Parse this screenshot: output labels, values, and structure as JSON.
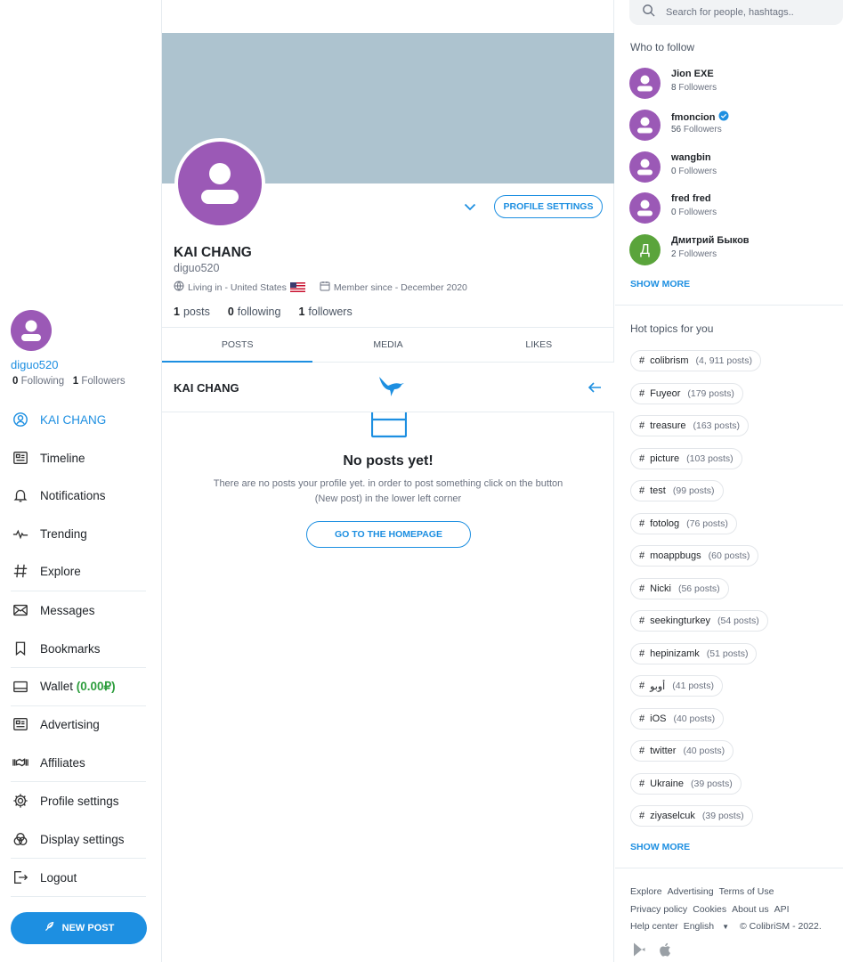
{
  "colors": {
    "accent": "#1d8fe1",
    "avatar_purple": "#9b59b6",
    "avatar_green": "#5aa43b",
    "cover": "#adc3cf",
    "wallet_green": "#2e9e3e"
  },
  "sidebar": {
    "username": "diguo520",
    "following_count": "0",
    "following_label": "Following",
    "followers_count": "1",
    "followers_label": "Followers",
    "items": [
      {
        "label": "KAI CHANG",
        "icon": "user-circle-icon"
      },
      {
        "label": "Timeline",
        "icon": "timeline-icon"
      },
      {
        "label": "Notifications",
        "icon": "bell-icon"
      },
      {
        "label": "Trending",
        "icon": "pulse-icon"
      },
      {
        "label": "Explore",
        "icon": "hashtag-icon"
      },
      {
        "label": "Messages",
        "icon": "envelope-icon"
      },
      {
        "label": "Bookmarks",
        "icon": "bookmark-icon"
      },
      {
        "label": "Wallet",
        "icon": "wallet-icon",
        "amount": "(0.00₽)"
      },
      {
        "label": "Advertising",
        "icon": "advertising-icon"
      },
      {
        "label": "Affiliates",
        "icon": "handshake-icon"
      },
      {
        "label": "Profile settings",
        "icon": "gear-icon"
      },
      {
        "label": "Display settings",
        "icon": "palette-icon"
      },
      {
        "label": "Logout",
        "icon": "logout-icon"
      }
    ],
    "new_post_label": "NEW POST"
  },
  "profile": {
    "name": "KAI CHANG",
    "handle": "diguo520",
    "location": "Living in - United States",
    "member_since": "Member since - December 2020",
    "settings_label": "PROFILE SETTINGS",
    "posts_count": "1",
    "posts_label": "posts",
    "following_count": "0",
    "following_label": "following",
    "followers_count": "1",
    "followers_label": "followers",
    "tabs": [
      "POSTS",
      "MEDIA",
      "LIKES"
    ]
  },
  "feed": {
    "title": "KAI CHANG",
    "empty_title": "No posts yet!",
    "empty_text": "There are no posts your profile yet. in order to post something click on the button (New post) in the lower left corner",
    "home_button": "GO TO THE HOMEPAGE"
  },
  "search": {
    "placeholder": "Search for people, hashtags.."
  },
  "who_to_follow": {
    "heading": "Who to follow",
    "users": [
      {
        "name": "Jion EXE",
        "followers": "8",
        "label": "Followers",
        "verified": false
      },
      {
        "name": "fmoncion",
        "followers": "56",
        "label": "Followers",
        "verified": true
      },
      {
        "name": "wangbin",
        "followers": "0",
        "label": "Followers",
        "verified": false
      },
      {
        "name": "fred fred",
        "followers": "0",
        "label": "Followers",
        "verified": false
      },
      {
        "name": "Дмитрий Быков",
        "followers": "2",
        "label": "Followers",
        "verified": false,
        "initial": "Д"
      }
    ],
    "show_more": "SHOW MORE"
  },
  "hot_topics": {
    "heading": "Hot topics for you",
    "topics": [
      {
        "tag": "colibrism",
        "count": "(4, 911 posts)"
      },
      {
        "tag": "Fuyeor",
        "count": "(179 posts)"
      },
      {
        "tag": "treasure",
        "count": "(163 posts)"
      },
      {
        "tag": "picture",
        "count": "(103 posts)"
      },
      {
        "tag": "test",
        "count": "(99 posts)"
      },
      {
        "tag": "fotolog",
        "count": "(76 posts)"
      },
      {
        "tag": "moappbugs",
        "count": "(60 posts)"
      },
      {
        "tag": "Nicki",
        "count": "(56 posts)"
      },
      {
        "tag": "seekingturkey",
        "count": "(54 posts)"
      },
      {
        "tag": "hepinizamk",
        "count": "(51 posts)"
      },
      {
        "tag": "أوبو",
        "count": "(41 posts)"
      },
      {
        "tag": "iOS",
        "count": "(40 posts)"
      },
      {
        "tag": "twitter",
        "count": "(40 posts)"
      },
      {
        "tag": "Ukraine",
        "count": "(39 posts)"
      },
      {
        "tag": "ziyaselcuk",
        "count": "(39 posts)"
      }
    ],
    "show_more": "SHOW MORE"
  },
  "footer": {
    "links": [
      "Explore",
      "Advertising",
      "Terms of Use",
      "Privacy policy",
      "Cookies",
      "About us",
      "API",
      "Help center"
    ],
    "language": "English",
    "copyright": "© ColibriSM - 2022."
  }
}
